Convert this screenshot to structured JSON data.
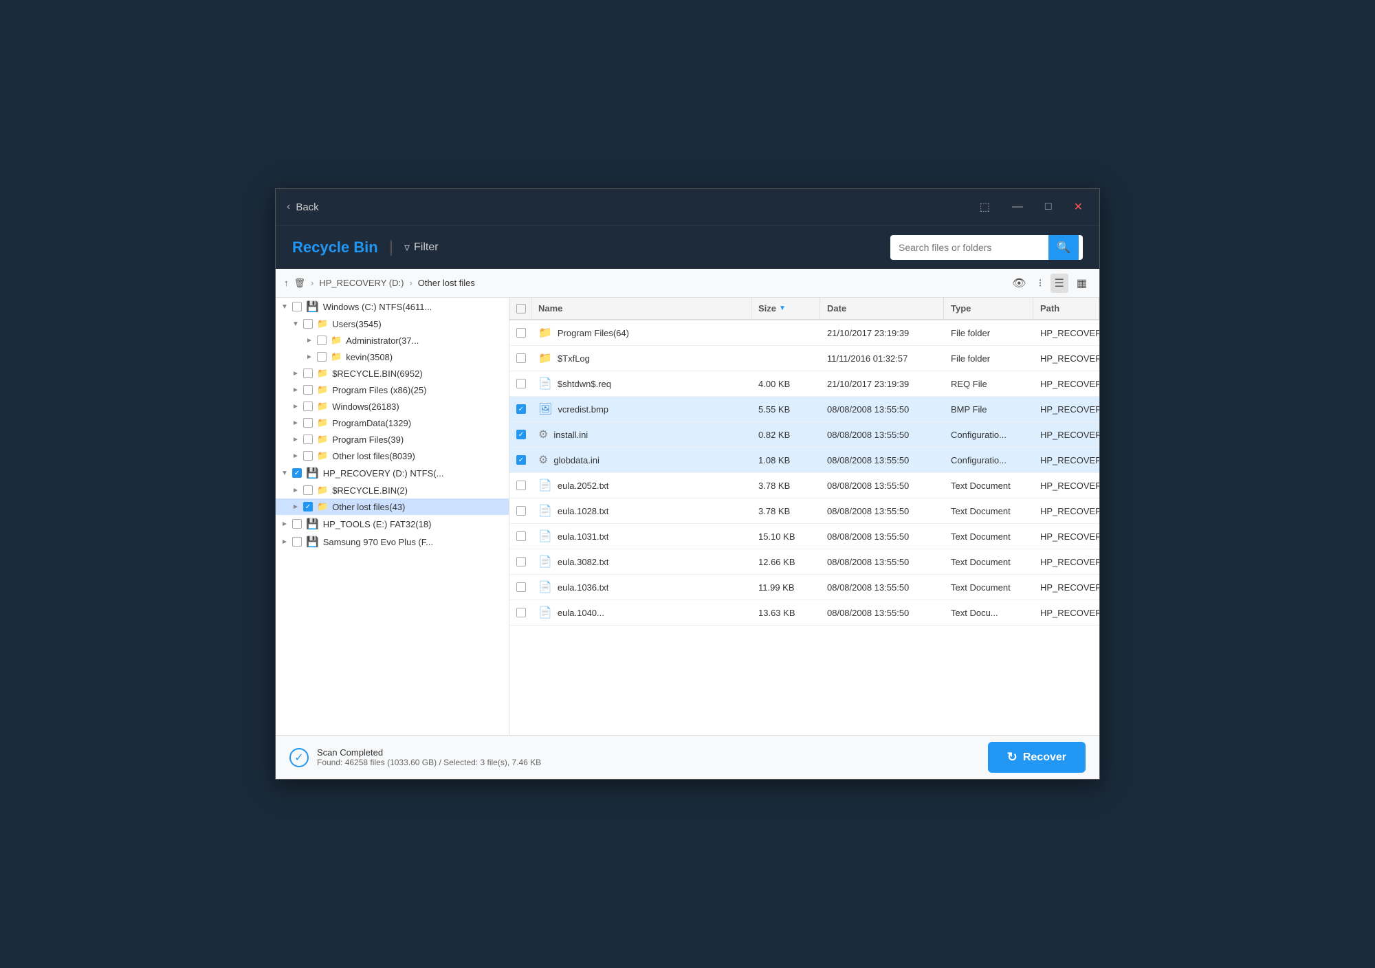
{
  "titleBar": {
    "backLabel": "Back",
    "buttons": [
      "⬚",
      "—",
      "□",
      "✕"
    ]
  },
  "header": {
    "recycleBinLabel": "Recycle Bin",
    "divider": "|",
    "filterLabel": "Filter",
    "searchPlaceholder": "Search files or folders"
  },
  "breadcrumb": {
    "upArrow": "↑",
    "trashIcon": "🗑",
    "path": [
      "HP_RECOVERY (D:)",
      "Other lost files"
    ]
  },
  "viewButtons": [
    "👁",
    "⊞",
    "☰",
    "▭"
  ],
  "sidebar": {
    "items": [
      {
        "id": "windows-c",
        "indent": 0,
        "expanded": true,
        "checked": false,
        "partial": false,
        "icon": "drive",
        "label": "Windows (C:) NTFS(4611..."
      },
      {
        "id": "users",
        "indent": 1,
        "expanded": true,
        "checked": false,
        "partial": false,
        "icon": "folder",
        "label": "Users(3545)"
      },
      {
        "id": "administrator",
        "indent": 2,
        "expanded": false,
        "checked": false,
        "partial": false,
        "icon": "folder",
        "label": "Administrator(37..."
      },
      {
        "id": "kevin",
        "indent": 2,
        "expanded": false,
        "checked": false,
        "partial": false,
        "icon": "folder",
        "label": "kevin(3508)"
      },
      {
        "id": "recycle-bin-c",
        "indent": 1,
        "expanded": false,
        "checked": false,
        "partial": false,
        "icon": "folder",
        "label": "$RECYCLE.BIN(6952)"
      },
      {
        "id": "program-files-x86",
        "indent": 1,
        "expanded": false,
        "checked": false,
        "partial": false,
        "icon": "folder",
        "label": "Program Files (x86)(25)"
      },
      {
        "id": "windows-folder",
        "indent": 1,
        "expanded": false,
        "checked": false,
        "partial": false,
        "icon": "folder",
        "label": "Windows(26183)"
      },
      {
        "id": "programdata",
        "indent": 1,
        "expanded": false,
        "checked": false,
        "partial": false,
        "icon": "folder",
        "label": "ProgramData(1329)"
      },
      {
        "id": "program-files",
        "indent": 1,
        "expanded": false,
        "checked": false,
        "partial": false,
        "icon": "folder",
        "label": "Program Files(39)"
      },
      {
        "id": "other-lost-c",
        "indent": 1,
        "expanded": false,
        "checked": false,
        "partial": false,
        "icon": "folder",
        "label": "Other lost files(8039)"
      },
      {
        "id": "hp-recovery-d",
        "indent": 0,
        "expanded": true,
        "checked": true,
        "partial": false,
        "icon": "drive",
        "label": "HP_RECOVERY (D:) NTFS(..."
      },
      {
        "id": "recycle-bin-d",
        "indent": 1,
        "expanded": false,
        "checked": false,
        "partial": false,
        "icon": "folder",
        "label": "$RECYCLE.BIN(2)"
      },
      {
        "id": "other-lost-d",
        "indent": 1,
        "expanded": false,
        "checked": true,
        "partial": false,
        "icon": "folder",
        "label": "Other lost files(43)",
        "selected": true
      },
      {
        "id": "hp-tools-e",
        "indent": 0,
        "expanded": false,
        "checked": false,
        "partial": false,
        "icon": "drive",
        "label": "HP_TOOLS (E:) FAT32(18)"
      },
      {
        "id": "samsung",
        "indent": 0,
        "expanded": false,
        "checked": false,
        "partial": false,
        "icon": "drive",
        "label": "Samsung 970 Evo Plus (F..."
      }
    ]
  },
  "tableColumns": [
    {
      "id": "check",
      "label": ""
    },
    {
      "id": "name",
      "label": "Name"
    },
    {
      "id": "size",
      "label": "Size",
      "sortable": true
    },
    {
      "id": "date",
      "label": "Date"
    },
    {
      "id": "type",
      "label": "Type"
    },
    {
      "id": "path",
      "label": "Path"
    }
  ],
  "tableRows": [
    {
      "checked": false,
      "icon": "folder",
      "name": "Program Files(64)",
      "size": "",
      "date": "21/10/2017 23:19:39",
      "type": "File folder",
      "path": "HP_RECOVERY (D:)\\..."
    },
    {
      "checked": false,
      "icon": "folder",
      "name": "$TxfLog",
      "size": "",
      "date": "11/11/2016 01:32:57",
      "type": "File folder",
      "path": "HP_RECOVERY (D:)\\..."
    },
    {
      "checked": false,
      "icon": "file",
      "name": "$shtdwn$.req",
      "size": "4.00 KB",
      "date": "21/10/2017 23:19:39",
      "type": "REQ File",
      "path": "HP_RECOVERY (D:)\\..."
    },
    {
      "checked": true,
      "icon": "bmp",
      "name": "vcredist.bmp",
      "size": "5.55 KB",
      "date": "08/08/2008 13:55:50",
      "type": "BMP File",
      "path": "HP_RECOVERY (D:)\\..."
    },
    {
      "checked": true,
      "icon": "ini",
      "name": "install.ini",
      "size": "0.82 KB",
      "date": "08/08/2008 13:55:50",
      "type": "Configuratio...",
      "path": "HP_RECOVERY (D:)\\..."
    },
    {
      "checked": true,
      "icon": "ini",
      "name": "globdata.ini",
      "size": "1.08 KB",
      "date": "08/08/2008 13:55:50",
      "type": "Configuratio...",
      "path": "HP_RECOVERY (D:)\\..."
    },
    {
      "checked": false,
      "icon": "txt",
      "name": "eula.2052.txt",
      "size": "3.78 KB",
      "date": "08/08/2008 13:55:50",
      "type": "Text Document",
      "path": "HP_RECOVERY (D:)\\..."
    },
    {
      "checked": false,
      "icon": "txt",
      "name": "eula.1028.txt",
      "size": "3.78 KB",
      "date": "08/08/2008 13:55:50",
      "type": "Text Document",
      "path": "HP_RECOVERY (D:)\\..."
    },
    {
      "checked": false,
      "icon": "txt",
      "name": "eula.1031.txt",
      "size": "15.10 KB",
      "date": "08/08/2008 13:55:50",
      "type": "Text Document",
      "path": "HP_RECOVERY (D:)\\..."
    },
    {
      "checked": false,
      "icon": "txt",
      "name": "eula.3082.txt",
      "size": "12.66 KB",
      "date": "08/08/2008 13:55:50",
      "type": "Text Document",
      "path": "HP_RECOVERY (D:)\\..."
    },
    {
      "checked": false,
      "icon": "txt",
      "name": "eula.1036.txt",
      "size": "11.99 KB",
      "date": "08/08/2008 13:55:50",
      "type": "Text Document",
      "path": "HP_RECOVERY (D:)\\..."
    },
    {
      "checked": false,
      "icon": "txt",
      "name": "eula.1040...",
      "size": "13.63 KB",
      "date": "08/08/2008 13:55:50",
      "type": "Text Docu...",
      "path": "HP_RECOVERY (D:)\\..."
    }
  ],
  "statusBar": {
    "scanCompleteLabel": "Scan Completed",
    "statsLabel": "Found: 46258 files (1033.60 GB) / Selected: 3 file(s), 7.46 KB",
    "recoverLabel": "Recover"
  },
  "colors": {
    "accent": "#2196f3",
    "titleBg": "#1e2b3a",
    "selectedRow": "#ddeeff"
  }
}
